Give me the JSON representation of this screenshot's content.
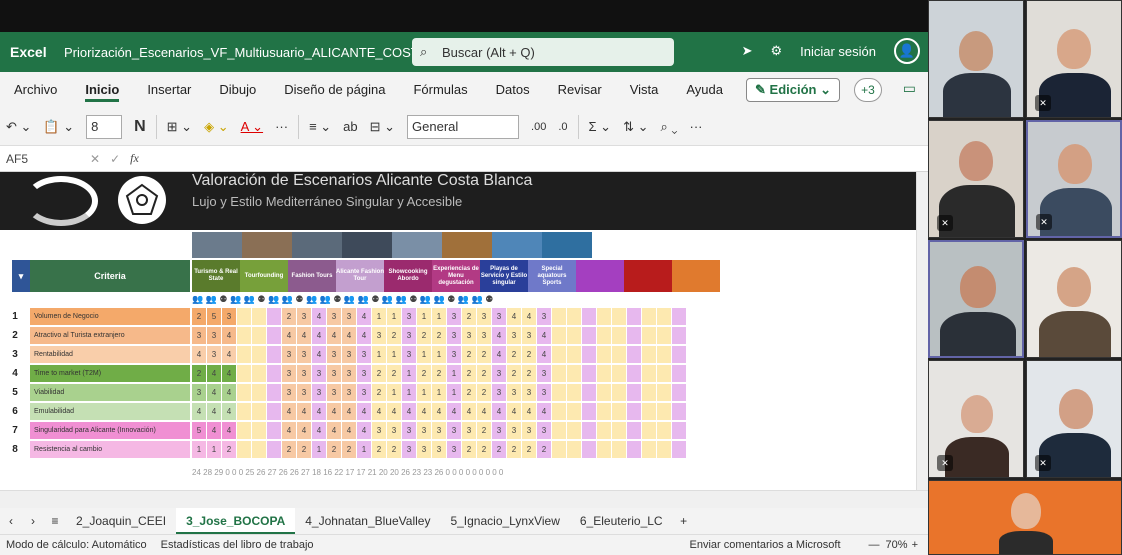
{
  "titlebar": {
    "app": "Excel",
    "filename": "Priorización_Escenarios_VF_Multiusuario_ALICANTE_COSTABLANCA",
    "search_placeholder": "Buscar (Alt + Q)",
    "signin": "Iniciar sesión"
  },
  "menu": {
    "tabs": [
      "Archivo",
      "Inicio",
      "Insertar",
      "Dibujo",
      "Diseño de página",
      "Fórmulas",
      "Datos",
      "Revisar",
      "Vista",
      "Ayuda"
    ],
    "edicion": "Edición",
    "plus3": "+3"
  },
  "ribbon": {
    "font_size": "8",
    "bold": "N",
    "number_format": "General",
    "dec_inc": ".00",
    "dec_dec": ".0"
  },
  "formulabar": {
    "name_box": "AF5",
    "fx": "fx"
  },
  "banner": {
    "title": "Valoración de Escenarios Alicante Costa Blanca",
    "subtitle": "Lujo y Estilo Mediterráneo Singular y Accesible"
  },
  "header": {
    "criteria": "Criteria",
    "columns": [
      "Turismo & Real State",
      "Tourfounding",
      "Fashion Tours",
      "Alicante Fashion Tour",
      "Showcooking Abordo",
      "Experiencias de Menu degustación",
      "Playas de Servicio y Estilo singular",
      "Special aquatours Sports"
    ]
  },
  "criteria_rows": [
    {
      "n": "1",
      "label": "Volumen de Negocio",
      "color": "#f4a96a",
      "vals": [
        "2",
        "5",
        "3",
        "",
        "",
        "",
        "2",
        "3",
        "4",
        "3",
        "3",
        "4",
        "1",
        "1",
        "3",
        "1",
        "1",
        "3",
        "2",
        "3",
        "3",
        "4",
        "4",
        "3"
      ]
    },
    {
      "n": "2",
      "label": "Atractivo al Turista extranjero",
      "color": "#f6b98a",
      "vals": [
        "3",
        "3",
        "4",
        "",
        "",
        "",
        "4",
        "4",
        "4",
        "4",
        "4",
        "4",
        "3",
        "2",
        "3",
        "2",
        "2",
        "3",
        "3",
        "3",
        "4",
        "3",
        "3",
        "4"
      ]
    },
    {
      "n": "3",
      "label": "Rentabilidad",
      "color": "#f9ceaa",
      "vals": [
        "4",
        "3",
        "4",
        "",
        "",
        "",
        "3",
        "3",
        "4",
        "3",
        "3",
        "3",
        "1",
        "1",
        "3",
        "1",
        "1",
        "3",
        "2",
        "2",
        "4",
        "2",
        "2",
        "4"
      ]
    },
    {
      "n": "4",
      "label": "Time to market (T2M)",
      "color": "#70ad47",
      "vals": [
        "2",
        "4",
        "4",
        "",
        "",
        "",
        "3",
        "3",
        "3",
        "3",
        "3",
        "3",
        "2",
        "2",
        "1",
        "2",
        "2",
        "1",
        "2",
        "2",
        "3",
        "2",
        "2",
        "3"
      ]
    },
    {
      "n": "5",
      "label": "Viabilidad",
      "color": "#a9d18e",
      "vals": [
        "3",
        "4",
        "4",
        "",
        "",
        "",
        "3",
        "3",
        "3",
        "3",
        "3",
        "3",
        "2",
        "1",
        "1",
        "1",
        "1",
        "1",
        "2",
        "2",
        "3",
        "3",
        "3",
        "3"
      ]
    },
    {
      "n": "6",
      "label": "Emulabilidad",
      "color": "#c5e0b4",
      "vals": [
        "4",
        "4",
        "4",
        "",
        "",
        "",
        "4",
        "4",
        "4",
        "4",
        "4",
        "4",
        "4",
        "4",
        "4",
        "4",
        "4",
        "4",
        "4",
        "4",
        "4",
        "4",
        "4",
        "4"
      ]
    },
    {
      "n": "7",
      "label": "Singularidad para Alicante (Innovación)",
      "color": "#f08fd3",
      "vals": [
        "5",
        "4",
        "4",
        "",
        "",
        "",
        "4",
        "4",
        "4",
        "4",
        "4",
        "4",
        "3",
        "3",
        "3",
        "3",
        "3",
        "3",
        "3",
        "2",
        "3",
        "3",
        "3",
        "3"
      ]
    },
    {
      "n": "8",
      "label": "Resistencia al cambio",
      "color": "#f5b8e4",
      "vals": [
        "1",
        "1",
        "2",
        "",
        "",
        "",
        "2",
        "2",
        "1",
        "2",
        "2",
        "1",
        "2",
        "2",
        "3",
        "3",
        "3",
        "3",
        "2",
        "2",
        "2",
        "2",
        "2",
        "2"
      ]
    }
  ],
  "totals": "24 28 29 0 0 0 25 26 27 26 26 27 18 16 22 17 17 21 20 20 26 23 23 26 0 0 0 0 0 0 0 0 0",
  "sheet_tabs": [
    "2_Joaquin_CEEI",
    "3_Jose_BOCOPA",
    "4_Johnatan_BlueValley",
    "5_Ignacio_LynxView",
    "6_Eleuterio_LC"
  ],
  "active_tab": "3_Jose_BOCOPA",
  "status": {
    "calc": "Modo de cálculo: Automático",
    "stats": "Estadísticas del libro de trabajo",
    "feedback": "Enviar comentarios a Microsoft",
    "zoom": "70%"
  }
}
